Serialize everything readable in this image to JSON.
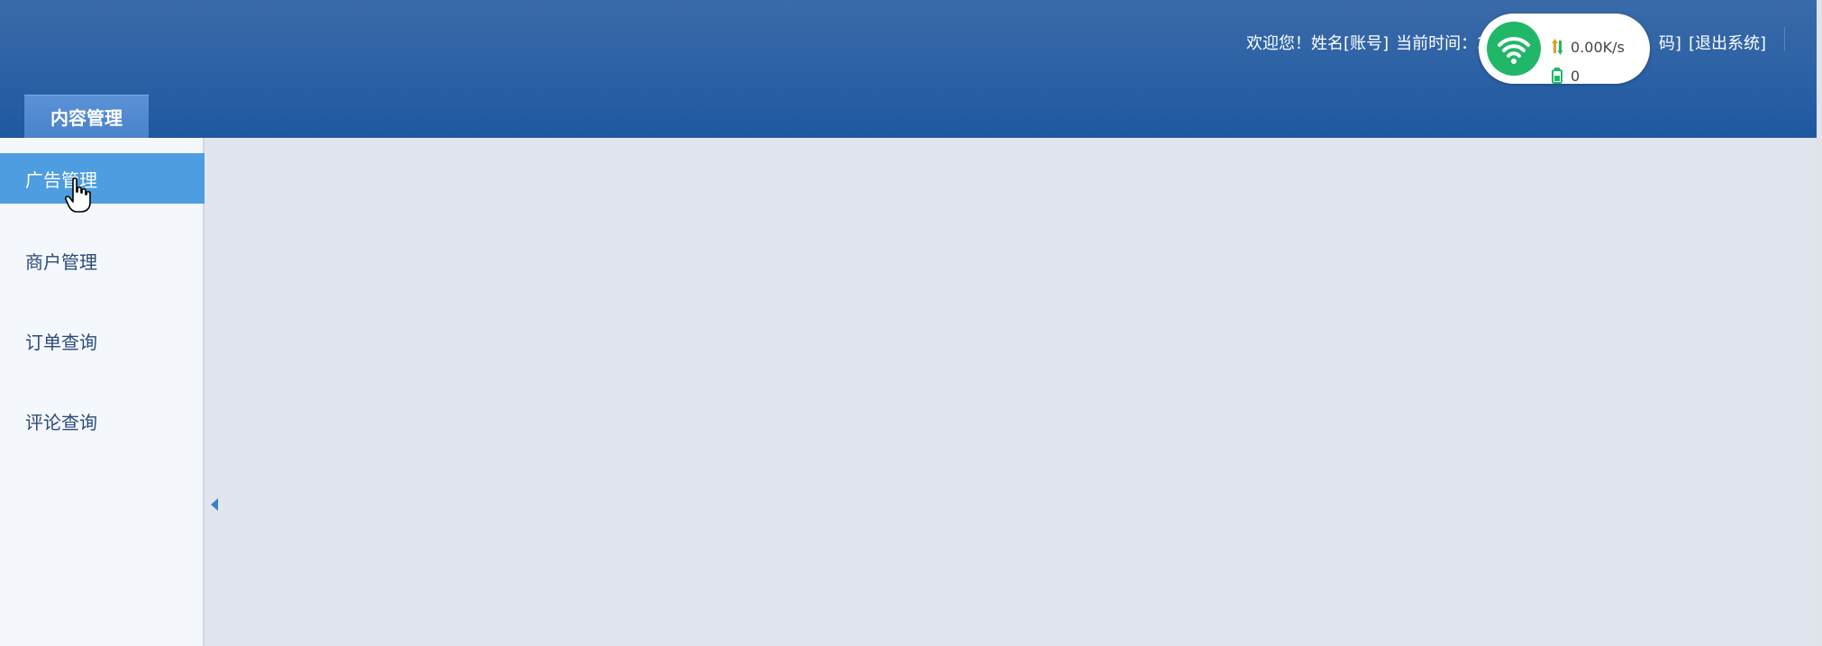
{
  "header": {
    "welcome": "欢迎您！姓名[账号]",
    "current_time_label": "当前时间：2017",
    "change_password": "码]",
    "logout": "[退出系统]"
  },
  "top_tabs": [
    {
      "label": "内容管理",
      "active": true
    }
  ],
  "sidebar": {
    "items": [
      {
        "label": "广告管理",
        "active": true
      },
      {
        "label": "商户管理",
        "active": false
      },
      {
        "label": "订单查询",
        "active": false
      },
      {
        "label": "评论查询",
        "active": false
      }
    ]
  },
  "net_widget": {
    "speed": "0.00K/s",
    "count": "0",
    "icon": "wifi-icon",
    "color": "#21b768"
  },
  "colors": {
    "header_blue": "#2e63a6",
    "active_menu": "#4d9de0",
    "main_bg": "#e1e6ee"
  }
}
